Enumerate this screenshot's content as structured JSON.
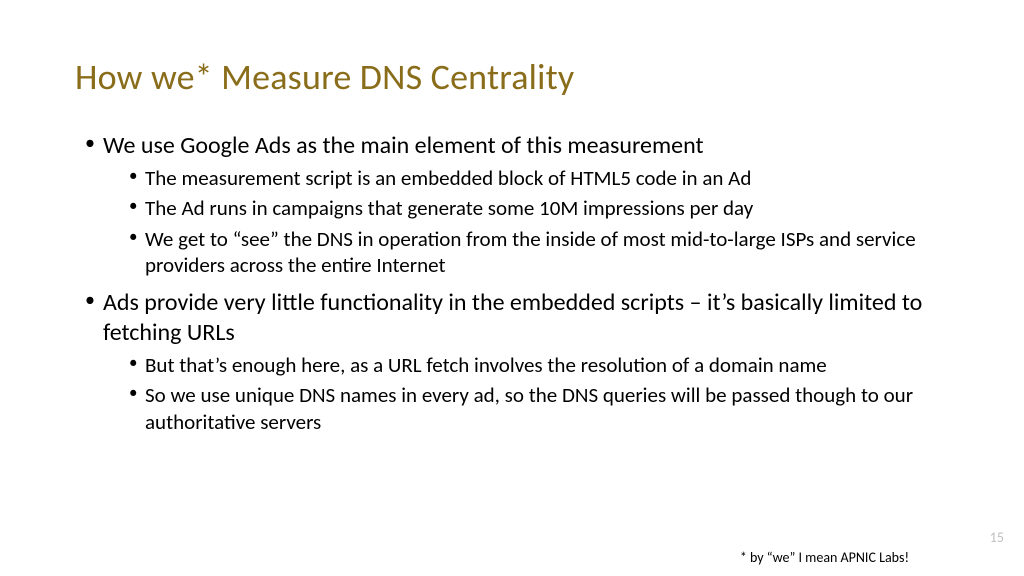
{
  "title": "How we* Measure DNS Centrality",
  "bullets": {
    "b1": {
      "text": "We use Google Ads as the main element of this measurement",
      "sub": {
        "s1": "The measurement script is an embedded block of HTML5 code in an Ad",
        "s2": "The Ad runs in campaigns that generate some 10M impressions per day",
        "s3": "We get to “see” the DNS in operation from the inside of most mid-to-large ISPs and service providers across the entire Internet"
      }
    },
    "b2": {
      "text": "Ads provide very little functionality in the embedded scripts – it’s basically limited to fetching URLs",
      "sub": {
        "s1": "But that’s enough here, as a URL fetch involves the resolution of a domain name",
        "s2": "So we use unique DNS names in every ad, so the DNS queries will be passed though to our authoritative servers"
      }
    }
  },
  "page_number": "15",
  "footnote": "* by “we” I mean  APNIC Labs!"
}
